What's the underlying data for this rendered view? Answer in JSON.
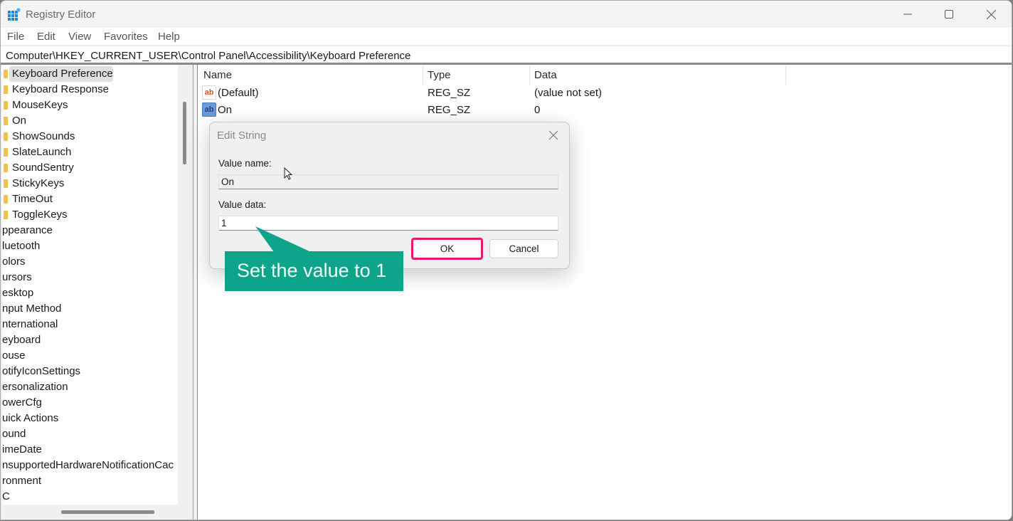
{
  "window": {
    "title": "Registry Editor",
    "controls": {
      "minimize": "minimize",
      "maximize": "maximize",
      "close": "close"
    }
  },
  "menu": [
    "File",
    "Edit",
    "View",
    "Favorites",
    "Help"
  ],
  "address": "Computer\\HKEY_CURRENT_USER\\Control Panel\\Accessibility\\Keyboard Preference",
  "tree": {
    "items": [
      {
        "label": "Keyboard Preference",
        "folder": true,
        "selected": true
      },
      {
        "label": "Keyboard Response",
        "folder": true
      },
      {
        "label": "MouseKeys",
        "folder": true
      },
      {
        "label": "On",
        "folder": true
      },
      {
        "label": "ShowSounds",
        "folder": true
      },
      {
        "label": "SlateLaunch",
        "folder": true
      },
      {
        "label": "SoundSentry",
        "folder": true
      },
      {
        "label": "StickyKeys",
        "folder": true
      },
      {
        "label": "TimeOut",
        "folder": true
      },
      {
        "label": "ToggleKeys",
        "folder": true
      },
      {
        "label": "ppearance"
      },
      {
        "label": "luetooth"
      },
      {
        "label": "olors"
      },
      {
        "label": "ursors"
      },
      {
        "label": "esktop"
      },
      {
        "label": "nput Method"
      },
      {
        "label": "nternational"
      },
      {
        "label": "eyboard"
      },
      {
        "label": "ouse"
      },
      {
        "label": "otifyIconSettings"
      },
      {
        "label": "ersonalization"
      },
      {
        "label": "owerCfg"
      },
      {
        "label": "uick Actions"
      },
      {
        "label": "ound"
      },
      {
        "label": "imeDate"
      },
      {
        "label": "nsupportedHardwareNotificationCac"
      },
      {
        "label": "ronment"
      },
      {
        "label": "C"
      }
    ]
  },
  "list": {
    "columns": [
      "Name",
      "Type",
      "Data"
    ],
    "rows": [
      {
        "icon": "string-value-icon",
        "name": "(Default)",
        "type": "REG_SZ",
        "data": "(value not set)"
      },
      {
        "icon": "string-value-icon",
        "name": "On",
        "type": "REG_SZ",
        "data": "0"
      }
    ]
  },
  "dialog": {
    "title": "Edit String",
    "value_name_label": "Value name:",
    "value_name": "On",
    "value_data_label": "Value data:",
    "value_data": "1",
    "ok_label": "OK",
    "cancel_label": "Cancel"
  },
  "annotation": {
    "text": "Set the value to 1",
    "color": "#0da58a",
    "highlight_color": "#e8196a"
  },
  "icon_colors": {
    "default_value": "#e0502a",
    "selected_value": "#4a7fc8",
    "folder": "#f0c24b",
    "app": "#1e88d8"
  }
}
